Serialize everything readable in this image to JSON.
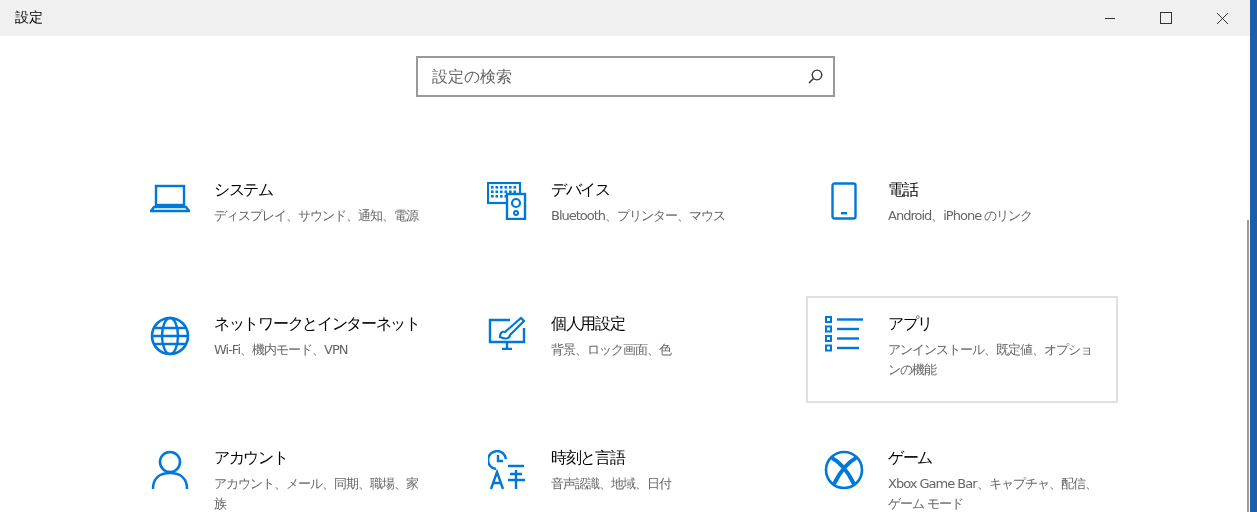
{
  "window": {
    "title": "設定"
  },
  "search": {
    "placeholder": "設定の検索"
  },
  "tiles": [
    {
      "title": "システム",
      "subtitle": "ディスプレイ、サウンド、通知、電源",
      "hovered": false
    },
    {
      "title": "デバイス",
      "subtitle": "Bluetooth、プリンター、マウス",
      "hovered": false
    },
    {
      "title": "電話",
      "subtitle": "Android、iPhone のリンク",
      "hovered": false
    },
    {
      "title": "ネットワークとインターネット",
      "subtitle": "Wi-Fi、機内モード、VPN",
      "hovered": false
    },
    {
      "title": "個人用設定",
      "subtitle": "背景、ロック画面、色",
      "hovered": false
    },
    {
      "title": "アプリ",
      "subtitle": "アンインストール、既定値、オプションの機能",
      "hovered": true
    },
    {
      "title": "アカウント",
      "subtitle": "アカウント、メール、同期、職場、家族",
      "hovered": false
    },
    {
      "title": "時刻と言語",
      "subtitle": "音声認識、地域、日付",
      "hovered": false
    },
    {
      "title": "ゲーム",
      "subtitle": "Xbox Game Bar、キャプチャ、配信、ゲーム モード",
      "hovered": false
    }
  ]
}
